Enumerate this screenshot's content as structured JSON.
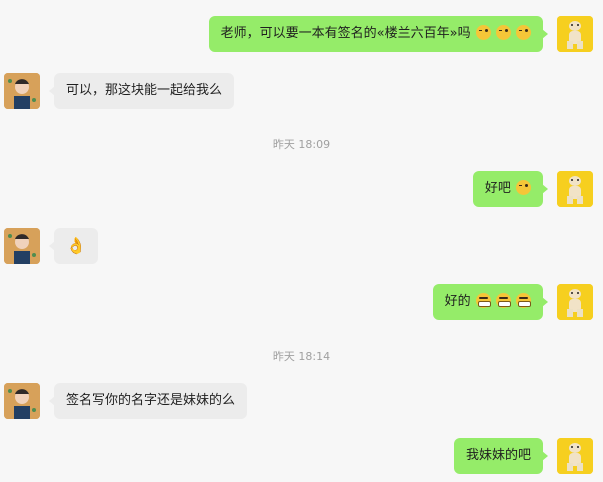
{
  "messages": [
    {
      "side": "self",
      "text": "老师，可以要一本有签名的«楼兰六百年»吗",
      "emojis": [
        "wink",
        "wink",
        "wink"
      ]
    },
    {
      "side": "other",
      "text": "可以，那这块能一起给我么"
    },
    {
      "side": "time",
      "text": "昨天 18:09"
    },
    {
      "side": "self",
      "text": "好吧",
      "emojis": [
        "wink"
      ]
    },
    {
      "side": "other",
      "text": "👌"
    },
    {
      "side": "self",
      "text": "好的",
      "emojis": [
        "grin",
        "grin",
        "grin"
      ]
    },
    {
      "side": "time",
      "text": "昨天 18:14"
    },
    {
      "side": "other",
      "text": "签名写你的名字还是妹妹的么"
    },
    {
      "side": "self",
      "text": "我妹妹的吧"
    }
  ]
}
